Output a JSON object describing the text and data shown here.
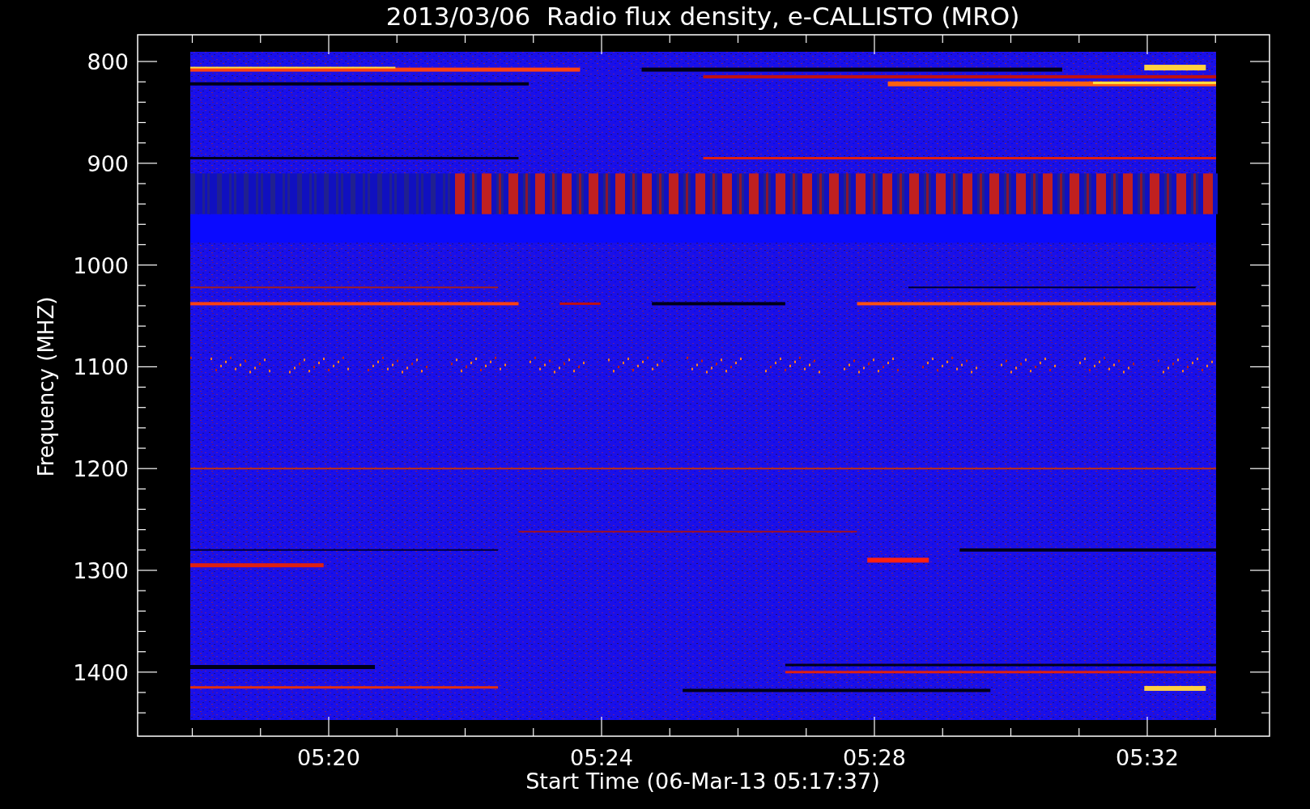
{
  "title": "2013/03/06  Radio flux density, e-CALLISTO (MRO)",
  "y_axis": {
    "label": "Frequency (MHZ)",
    "ticks": [
      "800",
      "900",
      "1000",
      "1100",
      "1200",
      "1300",
      "1400"
    ]
  },
  "x_axis": {
    "label": "Start Time (06-Mar-13 05:17:37)",
    "ticks": [
      "05:20",
      "05:24",
      "05:28",
      "05:32"
    ]
  }
}
